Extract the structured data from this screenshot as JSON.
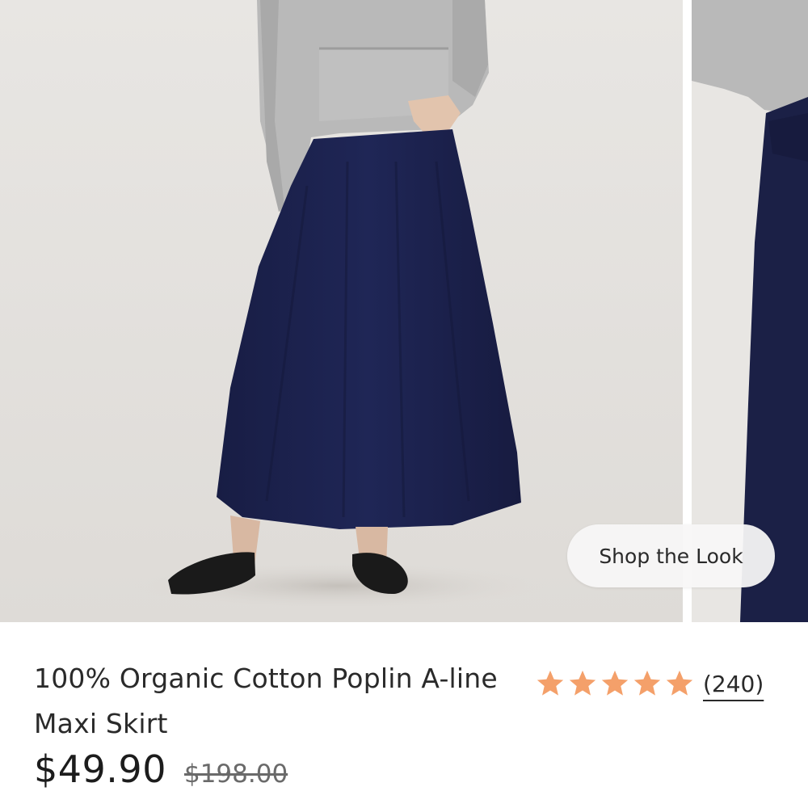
{
  "product": {
    "title": "100% Organic Cotton Poplin A-line Maxi Skirt",
    "price": "$49.90",
    "original_price": "$198.00",
    "rating": {
      "stars": 5,
      "max_stars": 5,
      "review_count": "(240)",
      "star_color": "#f4a06a"
    }
  },
  "gallery": {
    "shop_the_look_label": "Shop the Look",
    "skirt_color": "#1d2352",
    "sweater_color": "#b8b8b8",
    "background_color": "#e6e4e1"
  }
}
